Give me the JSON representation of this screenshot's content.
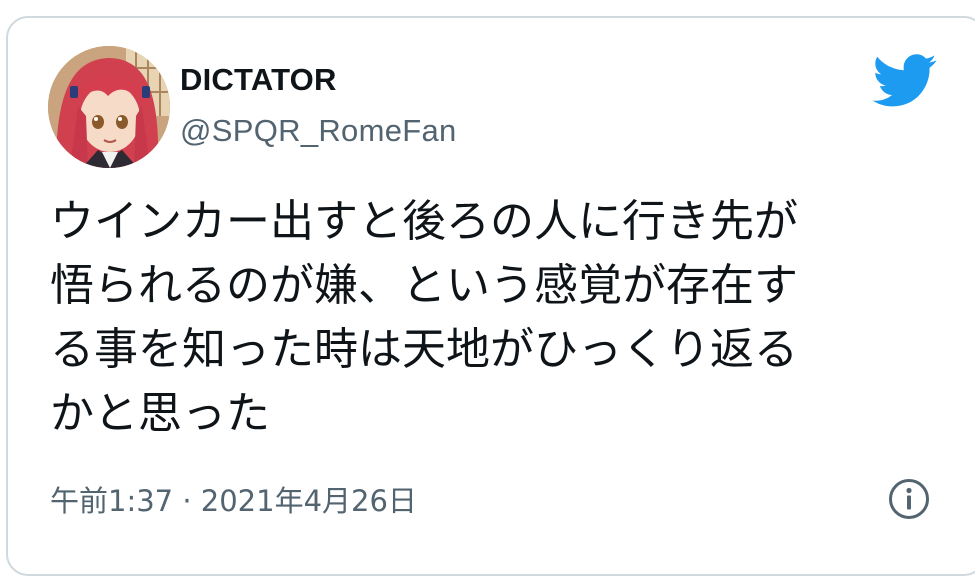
{
  "tweet": {
    "author": {
      "display_name": "DICTATOR",
      "handle": "@SPQR_RomeFan",
      "avatar_icon": "anime-girl-avatar"
    },
    "text": "ウインカー出すと後ろの人に行き先が\n悟られるのが嫌、という感覚が存在す\nる事を知った時は天地がひっくり返る\nかと思った",
    "timestamp": "午前1:37 · 2021年4月26日",
    "brand_icon": "twitter-bird-icon",
    "info_icon": "info-icon"
  },
  "colors": {
    "brand": "#1d9bf0",
    "text_primary": "#0f1419",
    "text_secondary": "#536471",
    "border": "#cfd9de"
  }
}
